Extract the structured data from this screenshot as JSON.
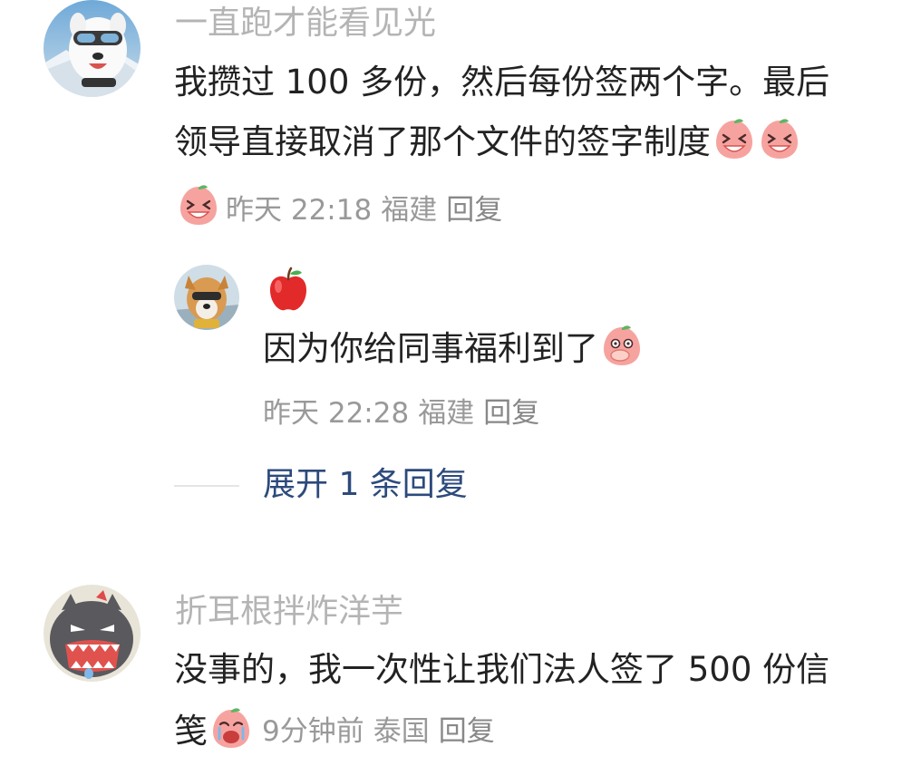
{
  "comments": [
    {
      "username": "一直跑才能看见光",
      "text_line1": "我攒过 100 多份，然后每份签两个字。最后",
      "text_line2": "领导直接取消了那个文件的签字制度",
      "time": "昨天 22:18",
      "location": "福建",
      "reply_label": "回复",
      "avatar_icon": "west-highland-terrier-avatar-icon",
      "emoji_icon": "laughing-peach-emoji-icon",
      "reply": {
        "badge_icon": "apple-badge-icon",
        "text": "因为你给同事福利到了",
        "emoji_icon": "covering-mouth-peach-emoji-icon",
        "time": "昨天 22:28",
        "location": "福建",
        "reply_label": "回复",
        "avatar_icon": "corgi-with-sunglasses-avatar-icon"
      },
      "expand_label": "展开 1 条回复"
    },
    {
      "username": "折耳根拌炸洋芋",
      "text_line1": "没事的，我一次性让我们法人签了 500 份信",
      "text_line2": "笺",
      "time": "9分钟前",
      "location": "泰国",
      "reply_label": "回复",
      "avatar_icon": "angry-gray-monster-avatar-icon",
      "emoji_icon": "crying-peach-emoji-icon"
    }
  ],
  "colors": {
    "username": "#b4b4b4",
    "body_text": "#222222",
    "meta_text": "#999999",
    "expand_link": "#2c4a7c",
    "emoji_peach": "#f6a3a0"
  }
}
